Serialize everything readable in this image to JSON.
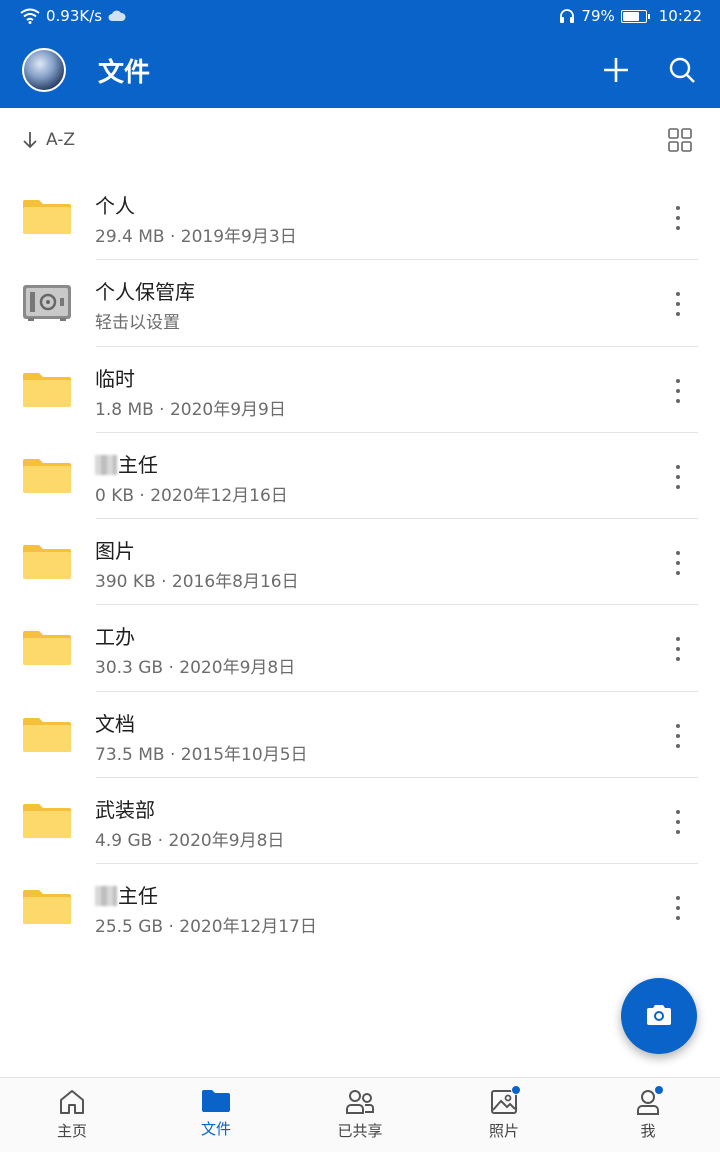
{
  "status_bar": {
    "speed": "0.93K/s",
    "battery_level": 79,
    "battery_text": "79%",
    "time": "10:22"
  },
  "header": {
    "title": "文件"
  },
  "sort": {
    "label": "A-Z"
  },
  "files": [
    {
      "name": "个人",
      "meta": "29.4 MB · 2019年9月3日",
      "icon": "folder-icon"
    },
    {
      "name": "个人保管库",
      "meta": "轻击以设置",
      "icon": "vault-icon"
    },
    {
      "name": "临时",
      "meta": "1.8 MB · 2020年9月9日",
      "icon": "folder-icon"
    },
    {
      "name": "主任",
      "meta": "0 KB · 2020年12月16日",
      "icon": "folder-icon",
      "redacted_prefix": true
    },
    {
      "name": "图片",
      "meta": "390 KB · 2016年8月16日",
      "icon": "folder-icon"
    },
    {
      "name": "工办",
      "meta": "30.3 GB · 2020年9月8日",
      "icon": "folder-icon"
    },
    {
      "name": "文档",
      "meta": "73.5 MB · 2015年10月5日",
      "icon": "folder-icon"
    },
    {
      "name": "武装部",
      "meta": "4.9 GB · 2020年9月8日",
      "icon": "folder-icon"
    },
    {
      "name": "主任",
      "meta": "25.5 GB · 2020年12月17日",
      "icon": "folder-icon",
      "redacted_prefix": true
    }
  ],
  "bottom_nav": [
    {
      "label": "主页",
      "icon": "home-icon"
    },
    {
      "label": "文件",
      "icon": "folder-icon",
      "active": true
    },
    {
      "label": "已共享",
      "icon": "people-icon"
    },
    {
      "label": "照片",
      "icon": "photo-icon",
      "badge": true
    },
    {
      "label": "我",
      "icon": "person-icon",
      "badge": true
    }
  ],
  "colors": {
    "brand": "#0a63c9",
    "folder": "#f5c13b",
    "folder_light": "#fdd96b"
  }
}
